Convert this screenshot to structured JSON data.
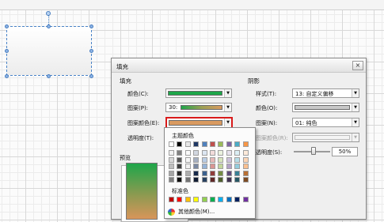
{
  "dialog": {
    "title": "填充",
    "close_glyph": "×",
    "fill": {
      "section": "填充",
      "color_label": "颜色(C):",
      "color_value": "#1ea64a",
      "pattern_label": "图案(P):",
      "pattern_value": "30:",
      "pattern_color_label": "图案颜色(E):",
      "pattern_color_value": "#d99a60",
      "transparency_label": "透明度(T):"
    },
    "preview_label": "预览",
    "shadow": {
      "section": "阴影",
      "style_label": "样式(T):",
      "style_value": "13: 自定义偏移",
      "color_label": "颜色(O):",
      "pattern_label": "图案(N):",
      "pattern_value": "01: 纯色",
      "pattern_color_label": "图案颜色(R):",
      "transparency_label": "透明度(S):",
      "transparency_value": "50%"
    }
  },
  "color_popup": {
    "theme_label": "主题颜色",
    "standard_label": "标准色",
    "more_label": "其他颜色(M)...",
    "theme_top_row": [
      "#ffffff",
      "#000000",
      "#e8e8e8",
      "#1f3864",
      "#4f81bd",
      "#c0504d",
      "#9bbb59",
      "#8064a2",
      "#4bacc6",
      "#f79646"
    ],
    "standard_row": [
      "#c00000",
      "#ff0000",
      "#ffc000",
      "#ffff00",
      "#92d050",
      "#00b050",
      "#00b0f0",
      "#0070c0",
      "#002060",
      "#7030a0"
    ]
  },
  "colors": {
    "selection": "#4a84c8",
    "highlight_border": "#d91a1a"
  }
}
